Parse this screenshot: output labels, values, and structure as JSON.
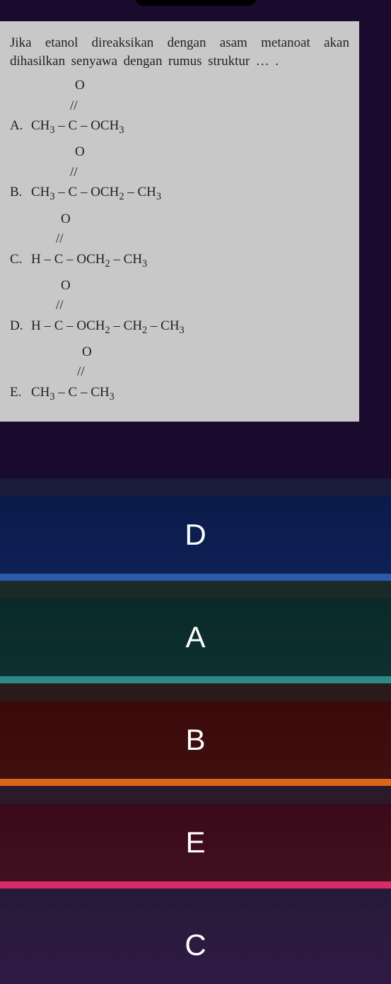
{
  "question": {
    "prompt": "Jika etanol direaksikan dengan asam metanoat akan dihasilkan senyawa dengan rumus struktur … .",
    "options": {
      "A": {
        "label": "A.",
        "formula_html": "CH₃ – C – OCH₃"
      },
      "B": {
        "label": "B.",
        "formula_html": "CH₃ – C – OCH₂ – CH₃"
      },
      "C": {
        "label": "C.",
        "formula_html": "H – C – OCH₂ – CH₃"
      },
      "D": {
        "label": "D.",
        "formula_html": "H – C – OCH₂ – CH₂ – CH₃"
      },
      "E": {
        "label": "E.",
        "formula_html": "CH₃ – C – CH₃"
      }
    },
    "carbonyl": {
      "o": "O",
      "slash": "//"
    }
  },
  "answers": {
    "d": "D",
    "a": "A",
    "b": "B",
    "e": "E",
    "c": "C"
  }
}
